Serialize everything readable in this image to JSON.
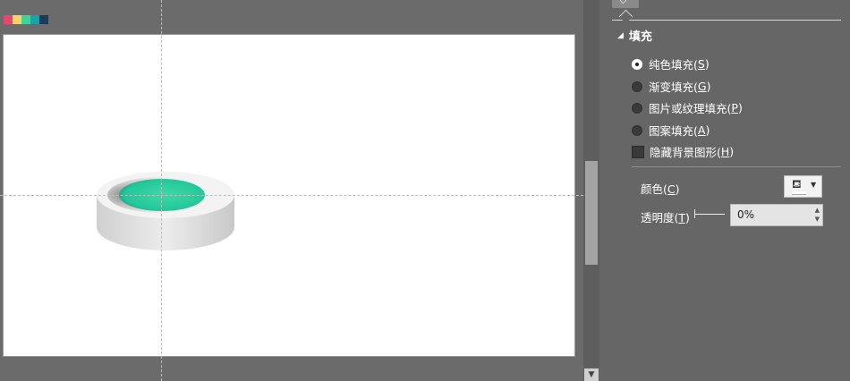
{
  "swatches": [
    {
      "name": "pink",
      "color": "#e7476f"
    },
    {
      "name": "yellow",
      "color": "#f6d36a"
    },
    {
      "name": "green",
      "color": "#3fd39c"
    },
    {
      "name": "teal",
      "color": "#1aa3a6"
    },
    {
      "name": "navy",
      "color": "#163d5c"
    }
  ],
  "shape": {
    "top_color": "#2ecf9f",
    "ring_color": "#f0f0f0",
    "side_color": "#d8d8d8"
  },
  "panel": {
    "tab_icon": "fill-bucket-icon",
    "section_title": "填充",
    "options": [
      {
        "text": "纯色填充(",
        "key": "S",
        "end": ")",
        "selected": true
      },
      {
        "text": "渐变填充(",
        "key": "G",
        "end": ")",
        "selected": false
      },
      {
        "text": "图片或纹理填充(",
        "key": "P",
        "end": ")",
        "selected": false
      },
      {
        "text": "图案填充(",
        "key": "A",
        "end": ")",
        "selected": false
      }
    ],
    "hide_bg": {
      "text": "隐藏背景图形(",
      "key": "H",
      "end": ")",
      "checked": false
    },
    "color": {
      "text": "颜色(",
      "key": "C",
      "end": ")",
      "current": "#ffffff"
    },
    "transparency": {
      "text": "透明度(",
      "key": "T",
      "end": ")",
      "value": "0%"
    }
  }
}
